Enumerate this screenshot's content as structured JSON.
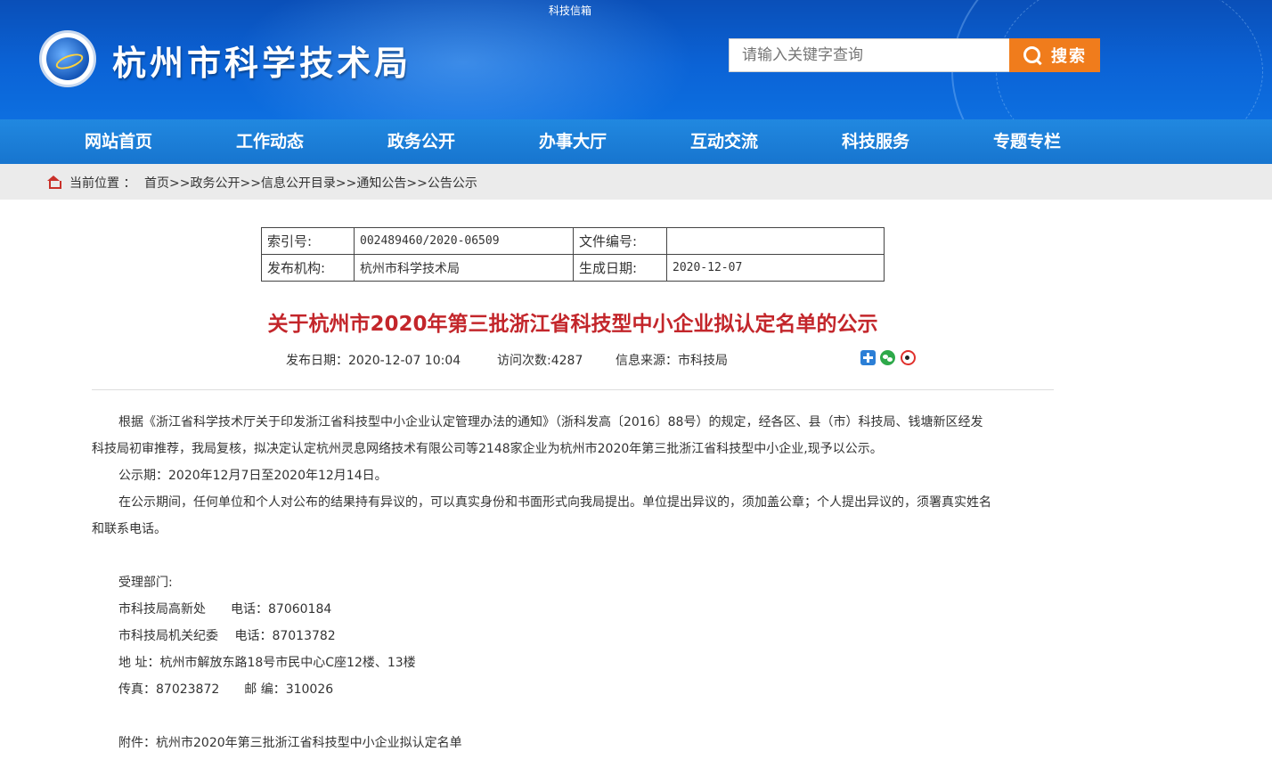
{
  "header": {
    "top_link": "科技信箱",
    "site_title": "杭州市科学技术局",
    "search_placeholder": "请输入关键字查询",
    "search_button": "搜索"
  },
  "nav": [
    "网站首页",
    "工作动态",
    "政务公开",
    "办事大厅",
    "互动交流",
    "科技服务",
    "专题专栏"
  ],
  "breadcrumb": {
    "label": "当前位置 ：",
    "path": "首页>>政务公开>>信息公开目录>>通知公告>>公告公示"
  },
  "meta": {
    "index_label": "索引号:",
    "index_value": "002489460/2020-06509",
    "doc_no_label": "文件编号:",
    "doc_no_value": "",
    "publisher_label": "发布机构:",
    "publisher_value": "杭州市科学技术局",
    "gen_date_label": "生成日期:",
    "gen_date_value": "2020-12-07"
  },
  "article": {
    "title": "关于杭州市2020年第三批浙江省科技型中小企业拟认定名单的公示",
    "publish_date": "发布日期：2020-12-07 10:04",
    "views": "访问次数:4287",
    "source": "信息来源：市科技局",
    "para1_line1": "根据《浙江省科学技术厅关于印发浙江省科技型中小企业认定管理办法的通知》（浙科发高〔2016〕88号）的规定，经各区、县（市）科技局、钱塘新区经发",
    "para1_line2": "科技局初审推荐，我局复核，拟决定认定杭州灵息网络技术有限公司等2148家企业为杭州市2020年第三批浙江省科技型中小企业,现予以公示。",
    "para2": "公示期：2020年12月7日至2020年12月14日。",
    "para3_line1": "在公示期间，任何单位和个人对公布的结果持有异议的，可以真实身份和书面形式向我局提出。单位提出异议的，须加盖公章；个人提出异议的，须署真实姓名",
    "para3_line2": "和联系电话。",
    "dept_label": "受理部门:",
    "dept1": "市科技局高新处　　电话：87060184",
    "dept2": "市科技局机关纪委　 电话：87013782",
    "address": "地 址：杭州市解放东路18号市民中心C座12楼、13楼",
    "fax": "传真：87023872　　邮 编：310026",
    "attachment": "附件：杭州市2020年第三批浙江省科技型中小企业拟认定名单"
  }
}
